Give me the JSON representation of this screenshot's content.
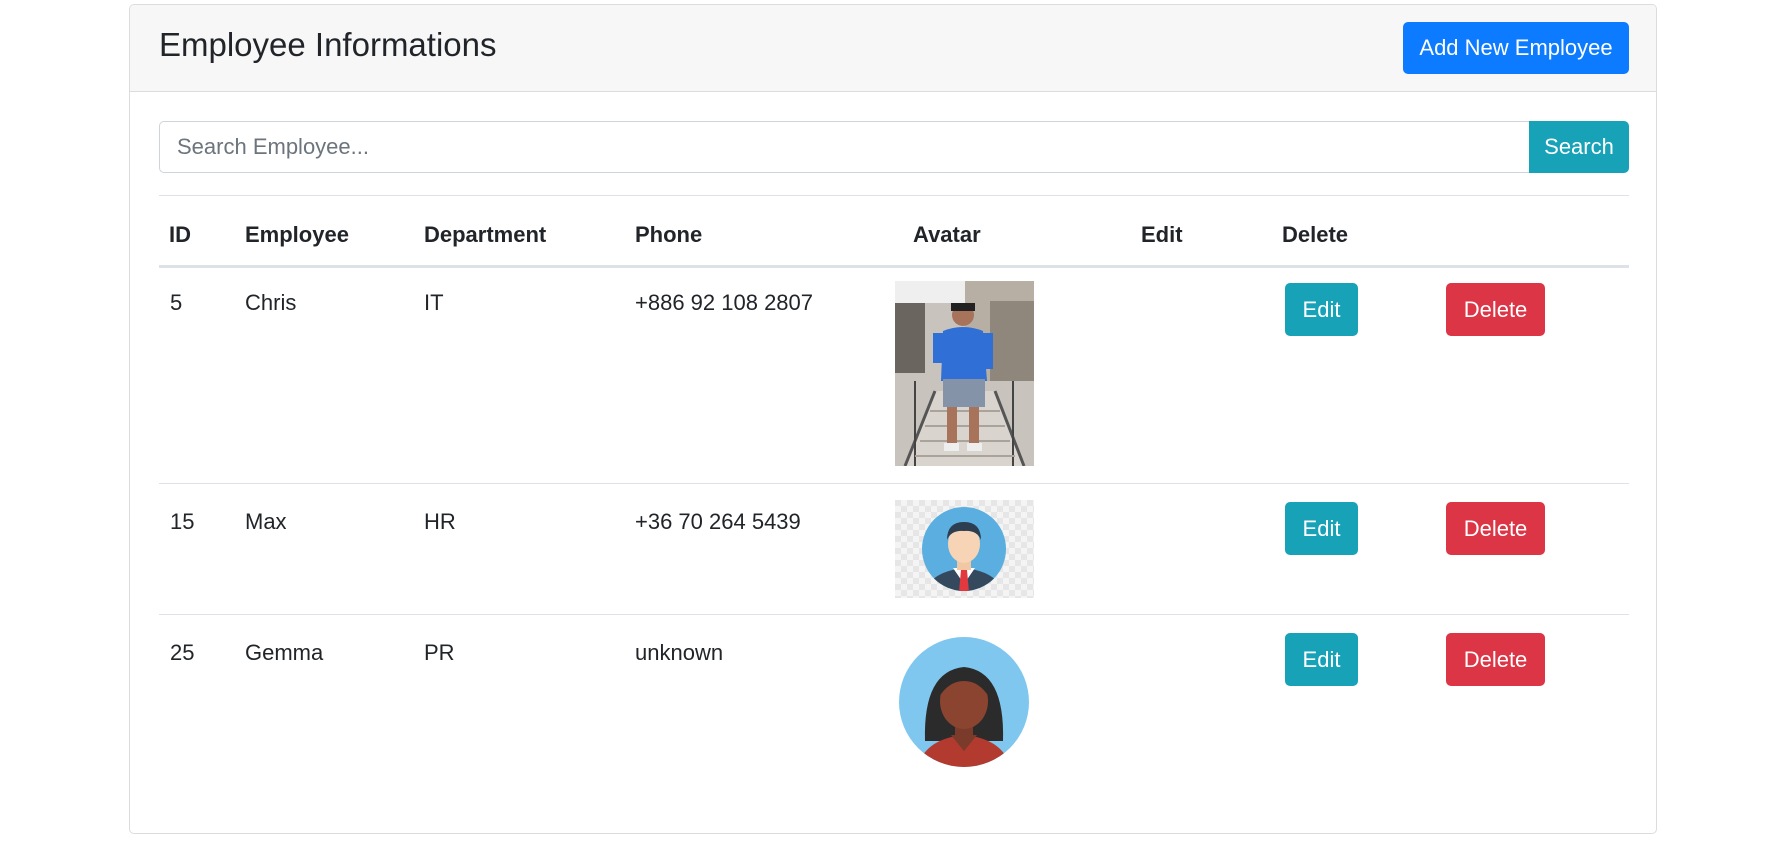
{
  "header": {
    "title": "Employee Informations",
    "add_button": "Add New Employee"
  },
  "search": {
    "placeholder": "Search Employee...",
    "value": "",
    "button": "Search"
  },
  "table": {
    "columns": [
      "ID",
      "Employee",
      "Department",
      "Phone",
      "Avatar",
      "Edit",
      "Delete"
    ],
    "rows": [
      {
        "id": "5",
        "employee": "Chris",
        "department": "IT",
        "phone": "+886 92 108 2807",
        "avatar": "photo-avatar",
        "edit": "Edit",
        "delete": "Delete"
      },
      {
        "id": "15",
        "employee": "Max",
        "department": "HR",
        "phone": "+36 70 264 5439",
        "avatar": "businessman-avatar-icon",
        "edit": "Edit",
        "delete": "Delete"
      },
      {
        "id": "25",
        "employee": "Gemma",
        "department": "PR",
        "phone": "unknown",
        "avatar": "woman-avatar-icon",
        "edit": "Edit",
        "delete": "Delete"
      }
    ]
  },
  "colors": {
    "primary": "#0d7bff",
    "info": "#17a2b8",
    "danger": "#dc3545",
    "header_bg": "#f7f7f7"
  }
}
